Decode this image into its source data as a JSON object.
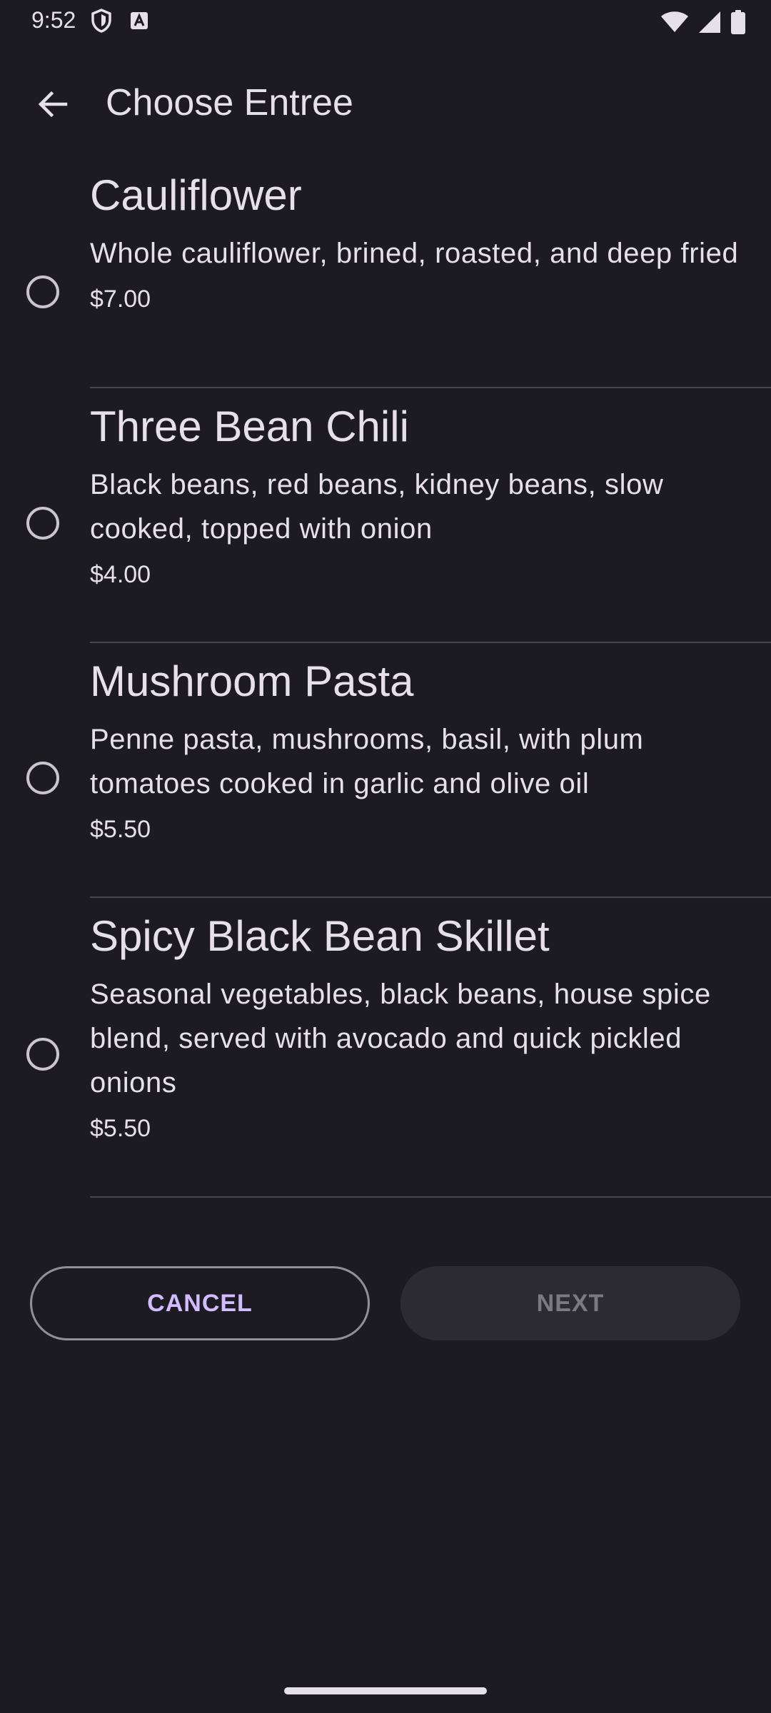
{
  "status_bar": {
    "time": "9:52",
    "left_icons": [
      "shield-icon",
      "autofill-badge-icon"
    ],
    "right_icons": [
      "wifi-icon",
      "cellular-signal-icon",
      "battery-icon"
    ]
  },
  "app_bar": {
    "back_icon": "arrow-back-icon",
    "title": "Choose Entree"
  },
  "entrees": [
    {
      "name": "Cauliflower",
      "description": "Whole cauliflower, brined, roasted, and deep fried",
      "price": "$7.00",
      "selected": false
    },
    {
      "name": "Three Bean Chili",
      "description": "Black beans, red beans, kidney beans, slow cooked, topped with onion",
      "price": "$4.00",
      "selected": false
    },
    {
      "name": "Mushroom Pasta",
      "description": "Penne pasta, mushrooms, basil, with plum tomatoes cooked in garlic and olive oil",
      "price": "$5.50",
      "selected": false
    },
    {
      "name": "Spicy Black Bean Skillet",
      "description": "Seasonal vegetables, black beans, house spice blend, served with avocado and quick pickled onions",
      "price": "$5.50",
      "selected": false
    }
  ],
  "buttons": {
    "cancel_label": "CANCEL",
    "next_label": "NEXT",
    "next_enabled": false
  },
  "colors": {
    "background": "#1c1b21",
    "accent": "#d0bcff",
    "on_surface": "#e6e1e9",
    "outline": "#938f99"
  }
}
